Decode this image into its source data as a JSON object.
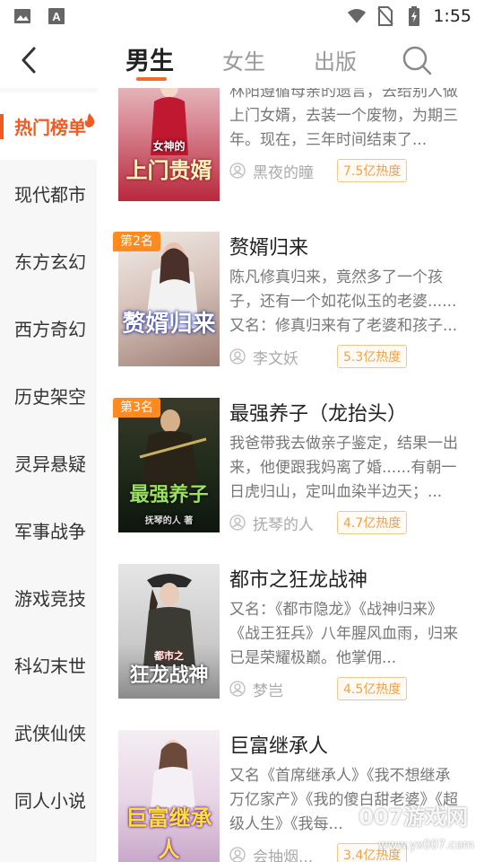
{
  "status_bar": {
    "time": "1:55",
    "icons": [
      "image-icon",
      "font-icon",
      "wifi-icon",
      "no-sim-icon",
      "battery-charging-icon"
    ]
  },
  "header": {
    "back_icon": "chevron-left-icon",
    "tabs": [
      {
        "label": "男生",
        "active": true
      },
      {
        "label": "女生",
        "active": false
      },
      {
        "label": "出版",
        "active": false
      }
    ],
    "search_icon": "search-icon",
    "accent_color": "#f26a2a"
  },
  "sidebar": {
    "items": [
      {
        "label": "热门榜单",
        "active": true
      },
      {
        "label": "现代都市"
      },
      {
        "label": "东方玄幻"
      },
      {
        "label": "西方奇幻"
      },
      {
        "label": "历史架空"
      },
      {
        "label": "灵异悬疑"
      },
      {
        "label": "军事战争"
      },
      {
        "label": "游戏竞技"
      },
      {
        "label": "科幻末世"
      },
      {
        "label": "武侠仙侠"
      },
      {
        "label": "同人小说"
      }
    ],
    "active_color": "#f05a23"
  },
  "books": [
    {
      "rank": "",
      "title": "",
      "cover_title": "上门贵婿",
      "cover_sub": "女神的",
      "description": "林阳遵循母亲的遗言，去给别人做上门女婿，去装一个废物，为期三年。现在，三年时间结束了...",
      "author": "黑夜的瞳",
      "heat": "7.5亿热度"
    },
    {
      "rank": "第2名",
      "title": "赘婿归来",
      "cover_title": "赘婿归来",
      "cover_sub": "",
      "description": "陈凡修真归来，竟然多了一个孩子，还有一个如花似玉的老婆......又名：修真归来有了老婆和孩子...",
      "author": "李文妖",
      "heat": "5.3亿热度"
    },
    {
      "rank": "第3名",
      "title": "最强养子（龙抬头）",
      "cover_title": "最强养子",
      "cover_sub": "抚琴的人 著",
      "description": "我爸带我去做亲子鉴定，结果一出来，他便跟我妈离了婚......有朝一日虎归山，定叫血染半边天；...",
      "author": "抚琴的人",
      "heat": "4.7亿热度"
    },
    {
      "rank": "",
      "title": "都市之狂龙战神",
      "cover_title": "狂龙战神",
      "cover_sub": "都市之",
      "description": "又名：《都市隐龙》《战神归来》《战王狂兵》八年腥风血雨，归来已是荣耀极巅。他掌佣...",
      "author": "梦岂",
      "heat": "4.5亿热度"
    },
    {
      "rank": "",
      "title": "巨富继承人",
      "cover_title": "巨富继承人",
      "cover_sub": "",
      "description": "又名《首席继承人》《我不想继承万亿家产》《我的傻白甜老婆》《超级人生》《我每...",
      "author": "会抽烟...",
      "heat": "3.4亿热度"
    }
  ],
  "watermark": {
    "text": "007游戏网",
    "url": "www.yx007.com"
  }
}
